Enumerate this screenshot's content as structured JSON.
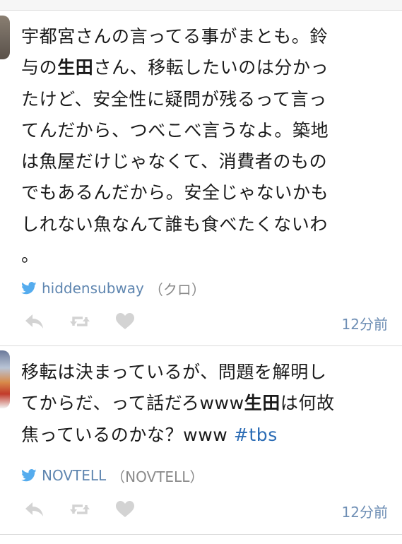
{
  "tweets": [
    {
      "text_lines": [
        "宇都宮さんの言ってる事がまとも。鈴",
        [
          "与の",
          "生田",
          "さん、移転したいのは分かっ"
        ],
        "たけど、安全性に疑問が残るって言っ",
        "てんだから、つべこべ言うなよ。築地",
        "は魚屋だけじゃなくて、消費者のもの",
        "でもあるんだから。安全じゃないかも",
        "しれない魚なんて誰も食べたくないわ",
        "。"
      ],
      "username": "hiddensubway",
      "display_name": "（クロ）",
      "time": "12分前"
    },
    {
      "text_lines": [
        "移転は決まっているが、問題を解明し",
        [
          "てからだ、って話だろwww",
          "生田",
          "は何故"
        ],
        [
          "焦っているのかな？www ",
          "#tbs",
          ""
        ]
      ],
      "username": "NOVTELL",
      "display_name": "（NOVTELL）",
      "time": "12分前"
    }
  ],
  "colors": {
    "link": "#2b6cb5",
    "author": "#5f86b0",
    "time": "#6f8fb5",
    "action_icon": "#d3d3d3",
    "separator": "#dcdcdc"
  },
  "icons": [
    "twitter-bird-icon",
    "reply-icon",
    "retweet-icon",
    "favorite-heart-icon"
  ]
}
